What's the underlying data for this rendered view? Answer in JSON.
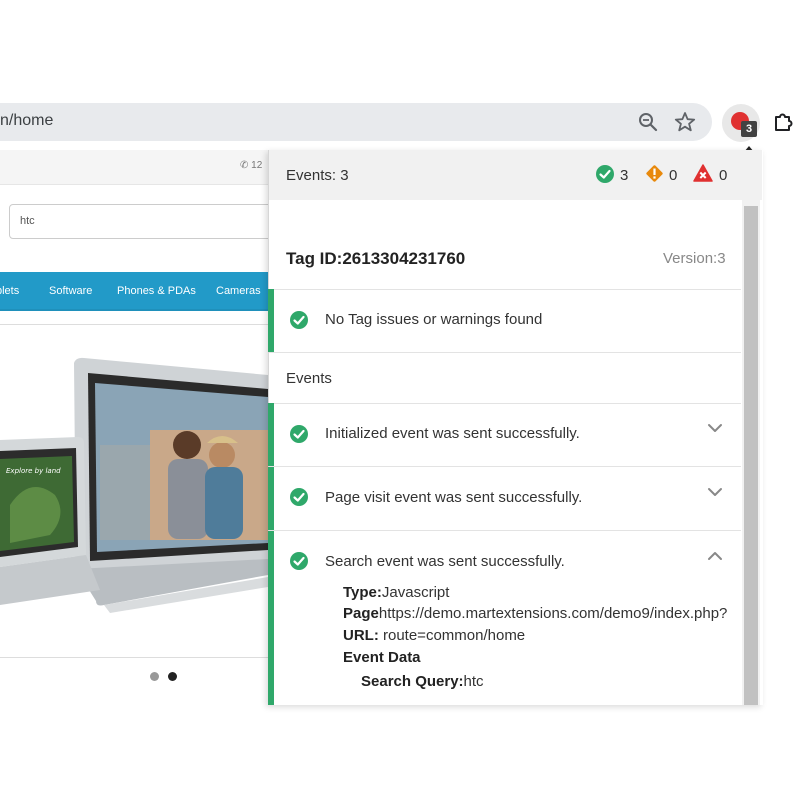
{
  "browser": {
    "url": "n/home",
    "extension_badge": "3",
    "icons": [
      "zoom-icon",
      "star-icon",
      "extension-logo",
      "puzzle-icon"
    ]
  },
  "site": {
    "topbar_phone": "12",
    "search_value": "htc",
    "nav_items": [
      "blets",
      "Software",
      "Phones & PDAs",
      "Cameras"
    ]
  },
  "popup": {
    "events_count": "Events: 3",
    "success_count": "3",
    "warning_count": "0",
    "error_count": "0",
    "tag_id": "Tag ID:2613304231760",
    "version": "Version:3",
    "no_issues": "No Tag issues or warnings found",
    "events_label": "Events",
    "events": [
      {
        "text": "Initialized event was sent successfully.",
        "expanded": false
      },
      {
        "text": "Page visit event was sent successfully.",
        "expanded": false
      },
      {
        "text": "Search event was sent successfully.",
        "expanded": true
      }
    ],
    "details": {
      "type_label": "Type:",
      "type_value": "Javascript",
      "page_label": "Page",
      "page_value": "https://demo.martextensions.com/demo9/index.php?",
      "url_label": "URL:",
      "url_value": " route=common/home",
      "event_data_label": "Event Data",
      "search_query_label": "Search Query:",
      "search_query_value": "htc"
    }
  },
  "colors": {
    "accent_green": "#2fa86a",
    "warning": "#e8890c",
    "error": "#e03131",
    "nav_blue": "#229ac8"
  }
}
